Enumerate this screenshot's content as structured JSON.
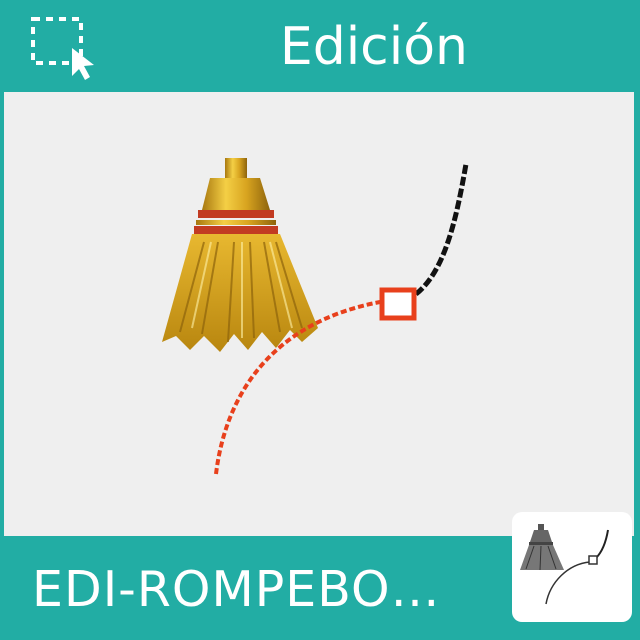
{
  "header": {
    "title": "Edición",
    "icon": "selection-marquee-icon"
  },
  "main": {
    "illustration_icons": [
      "broom-icon",
      "curve-edit-icon"
    ]
  },
  "footer": {
    "label": "EDI-ROMPEBO…",
    "thumbnail_icon": "broom-curve-thumbnail-icon"
  },
  "colors": {
    "accent": "#22ada4",
    "canvas": "#efefef",
    "curve_red": "#e8401c",
    "curve_black": "#111111",
    "broom_gold": "#d9a520"
  }
}
